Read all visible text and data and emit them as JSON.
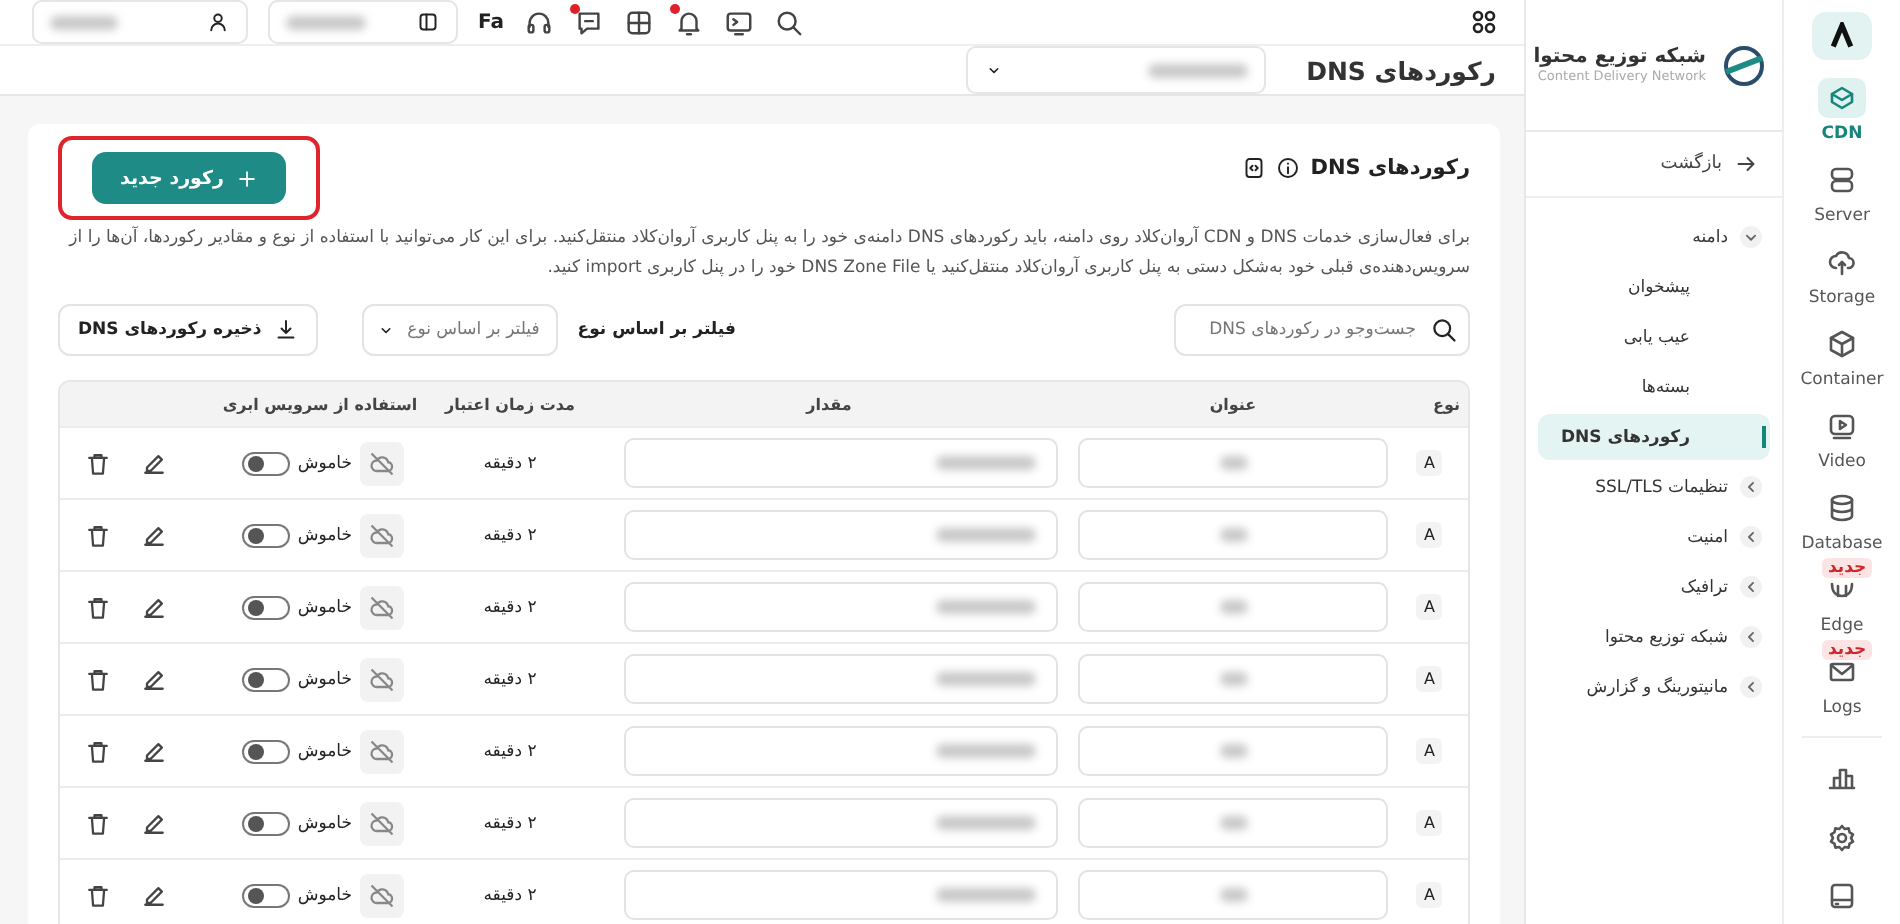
{
  "rail": {
    "items": [
      {
        "label": "CDN",
        "selected": true
      },
      {
        "label": "Server",
        "selected": false
      },
      {
        "label": "Storage",
        "selected": false
      },
      {
        "label": "Container",
        "selected": false
      },
      {
        "label": "Video",
        "selected": false
      },
      {
        "label": "Database",
        "selected": false
      },
      {
        "label": "Edge",
        "selected": false,
        "badge": "جدید"
      },
      {
        "label": "Logs",
        "selected": false,
        "badge": "جدید"
      }
    ]
  },
  "nav": {
    "title": "شبکه توزیع محتوا",
    "subtitle": "Content Delivery Network",
    "back": "بازگشت",
    "items": [
      {
        "label": "دامنه",
        "selected": false,
        "expanded": true,
        "children": [
          {
            "label": "پیشخوان",
            "selected": false
          },
          {
            "label": "عیب یابی",
            "selected": false
          },
          {
            "label": "بسته‌ها",
            "selected": false
          },
          {
            "label": "رکوردهای DNS",
            "selected": true
          }
        ]
      },
      {
        "label": "تنظیمات SSL/TLS",
        "selected": false,
        "expanded": false
      },
      {
        "label": "امنیت",
        "selected": false,
        "expanded": false
      },
      {
        "label": "ترافیک",
        "selected": false,
        "expanded": false
      },
      {
        "label": "شبکه توزیع محتوا",
        "selected": false,
        "expanded": false
      },
      {
        "label": "مانیتورینگ و گزارش",
        "selected": false,
        "expanded": false
      }
    ]
  },
  "toolbar": {
    "language": "Fa",
    "icons": [
      {
        "kind": "search",
        "unread": false
      },
      {
        "kind": "terminal",
        "unread": false
      },
      {
        "kind": "bell",
        "unread": true
      },
      {
        "kind": "qr",
        "unread": false
      },
      {
        "kind": "chat",
        "unread": true
      },
      {
        "kind": "headset",
        "unread": false
      }
    ]
  },
  "page_title": "رکوردهای DNS",
  "card": {
    "title": "رکوردهای DNS",
    "description": "برای فعال‌سازی خدمات DNS و CDN آروان‌کلاد روی دامنه، باید رکوردهای DNS دامنه‌ی خود را به پنل کاربری آروان‌کلاد منتقل‌کنید. برای این کار می‌توانید با استفاده از نوع و مقادیر رکوردها، آن‌ها را از سرویس‌دهنده‌ی قبلی خود به‌شکل دستی به پنل کاربری آروان‌کلاد منتقل‌کنید یا DNS Zone File خود را در پنل کاربری import کنید.",
    "new_button": "رکورد جدید",
    "search": {
      "placeholder": "جست‌وجو در رکوردهای DNS"
    },
    "filter_label": "فیلتر بر اساس نوع",
    "filter": {
      "placeholder": "فیلتر بر اساس نوع"
    },
    "save_button": "ذخیره رکوردهای DNS"
  },
  "table": {
    "columns": [
      "نوع",
      "عنوان",
      "مقدار",
      "مدت زمان اعتبار",
      "استفاده از سرویس ابری"
    ],
    "rows": [
      {
        "type": "A",
        "ttl": "۲ دقیقه",
        "cloud": "خاموش",
        "cloud_on": false
      },
      {
        "type": "A",
        "ttl": "۲ دقیقه",
        "cloud": "خاموش",
        "cloud_on": false
      },
      {
        "type": "A",
        "ttl": "۲ دقیقه",
        "cloud": "خاموش",
        "cloud_on": false
      },
      {
        "type": "A",
        "ttl": "۲ دقیقه",
        "cloud": "خاموش",
        "cloud_on": false
      },
      {
        "type": "A",
        "ttl": "۲ دقیقه",
        "cloud": "خاموش",
        "cloud_on": false
      },
      {
        "type": "A",
        "ttl": "۲ دقیقه",
        "cloud": "خاموش",
        "cloud_on": false
      },
      {
        "type": "A",
        "ttl": "۲ دقیقه",
        "cloud": "خاموش",
        "cloud_on": false
      }
    ]
  }
}
